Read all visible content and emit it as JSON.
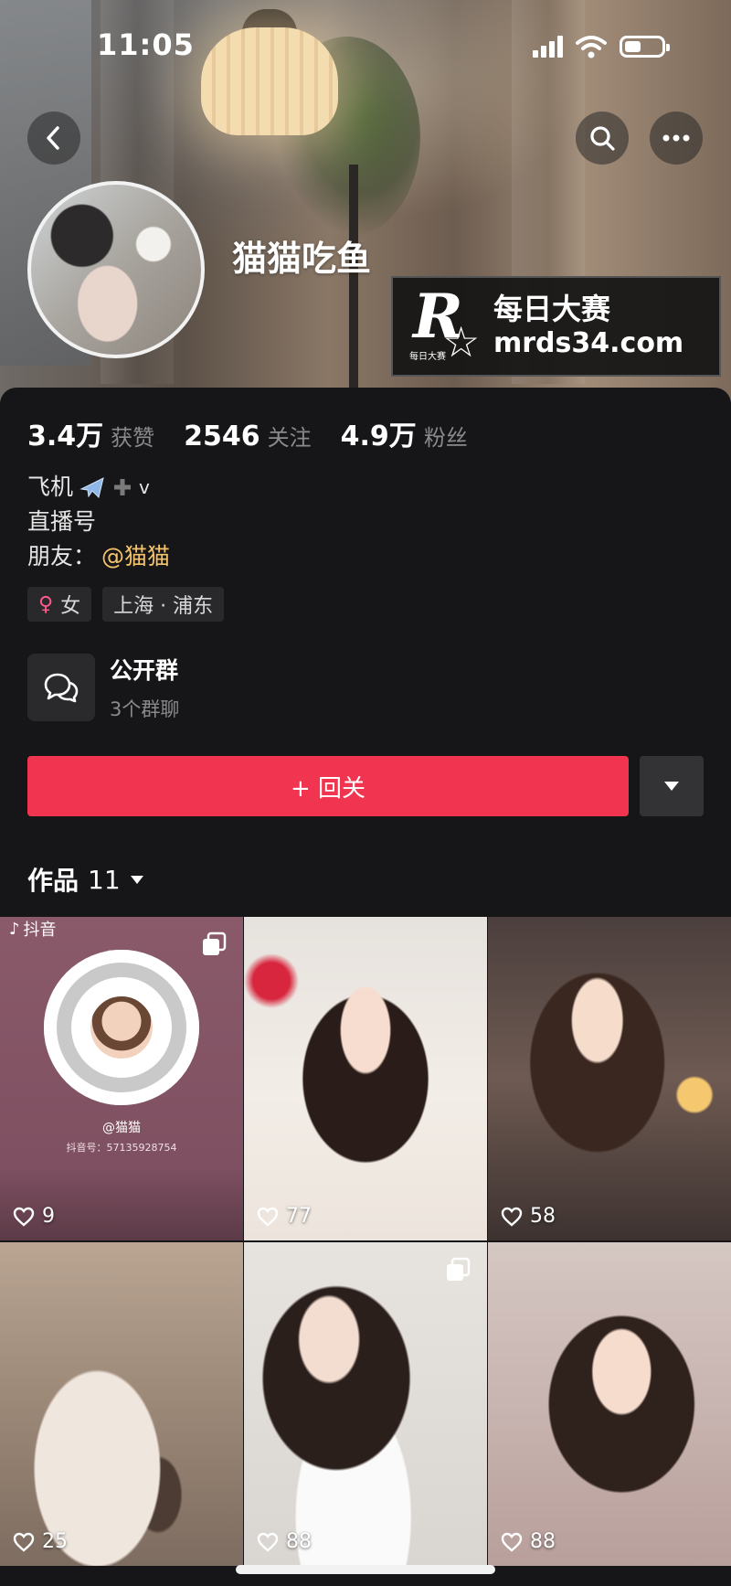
{
  "status_bar": {
    "time": "11:05"
  },
  "profile": {
    "nickname": "猫猫吃鱼",
    "stats": [
      {
        "value": "3.4万",
        "label": "获赞"
      },
      {
        "value": "2546",
        "label": "关注"
      },
      {
        "value": "4.9万",
        "label": "粉丝"
      }
    ],
    "bio": {
      "line1_text": "飞机",
      "line1_suffix": "v",
      "line2": "直播号",
      "friend_prefix": "朋友：",
      "friend_name": "@猫猫"
    },
    "tags": {
      "gender": "女",
      "location": "上海 · 浦东"
    },
    "group": {
      "title": "公开群",
      "subtitle": "3个群聊"
    },
    "follow_button": "+ 回关",
    "works_tab": {
      "label": "作品",
      "count": "11"
    }
  },
  "watermark": {
    "logo_letter": "R",
    "logo_small": "每日大赛",
    "title": "每日大赛",
    "url": "mrds34.com"
  },
  "posts": [
    {
      "likes": "9",
      "brand": "抖音",
      "qr_name": "@猫猫",
      "qr_id": "抖音号：57135928754"
    },
    {
      "likes": "77"
    },
    {
      "likes": "58"
    },
    {
      "likes": "25"
    },
    {
      "likes": "88"
    },
    {
      "likes": "88"
    }
  ],
  "colors": {
    "accent": "#f1344f",
    "friend_link": "#f5c46a",
    "panel": "#161618"
  },
  "icons": [
    "back-icon",
    "search-icon",
    "more-icon",
    "signal-icon",
    "wifi-icon",
    "battery-icon",
    "airplane-icon",
    "plus-icon",
    "female-icon",
    "chat-group-icon",
    "caret-down-icon",
    "heart-icon",
    "multi-image-icon",
    "douyin-icon"
  ]
}
